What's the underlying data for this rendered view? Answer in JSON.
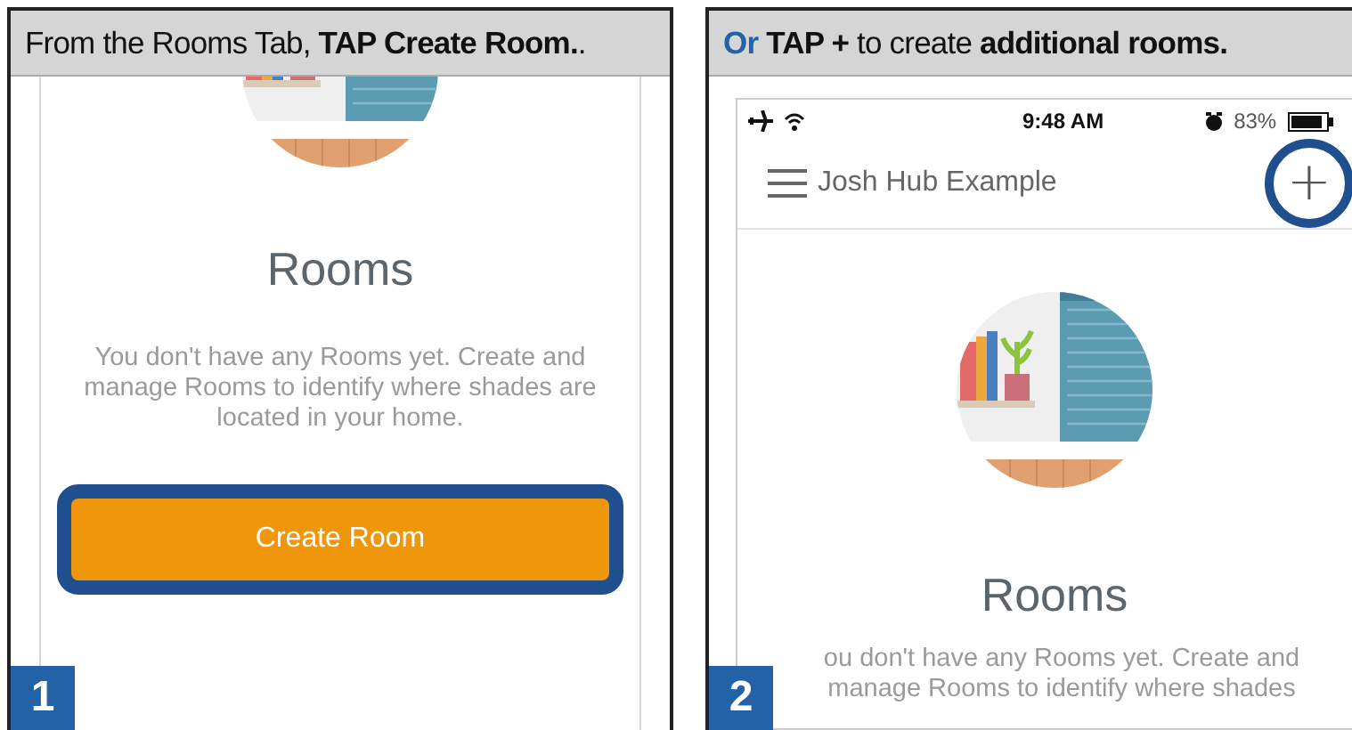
{
  "panels": [
    {
      "number": "1",
      "caption": [
        {
          "kind": "plain",
          "text": "From the Rooms Tab, "
        },
        {
          "kind": "bold",
          "text": "TAP Create Room."
        },
        {
          "kind": "plain",
          "text": "."
        }
      ],
      "screen": {
        "kind": "scrolled",
        "title": "Rooms",
        "message": "You don't have any Rooms yet. Create and manage Rooms to identify where shades are located in your home.",
        "button": {
          "label": "Create Room",
          "highlighted": true
        }
      }
    },
    {
      "number": "2",
      "caption": [
        {
          "kind": "accent",
          "text": "Or"
        },
        {
          "kind": "bold",
          "text": " TAP + "
        },
        {
          "kind": "plain",
          "text": "to create "
        },
        {
          "kind": "bold",
          "text": "additional rooms."
        }
      ],
      "screen": {
        "kind": "top",
        "status_bar": {
          "time": "9:48 AM",
          "battery": "83%"
        },
        "nav": {
          "title": "Josh Hub Example",
          "add": {
            "label": "+",
            "highlighted": true
          }
        },
        "title": "Rooms",
        "message": "ou don't have any Rooms yet. Create and manage Rooms to identify where shades"
      }
    }
  ]
}
